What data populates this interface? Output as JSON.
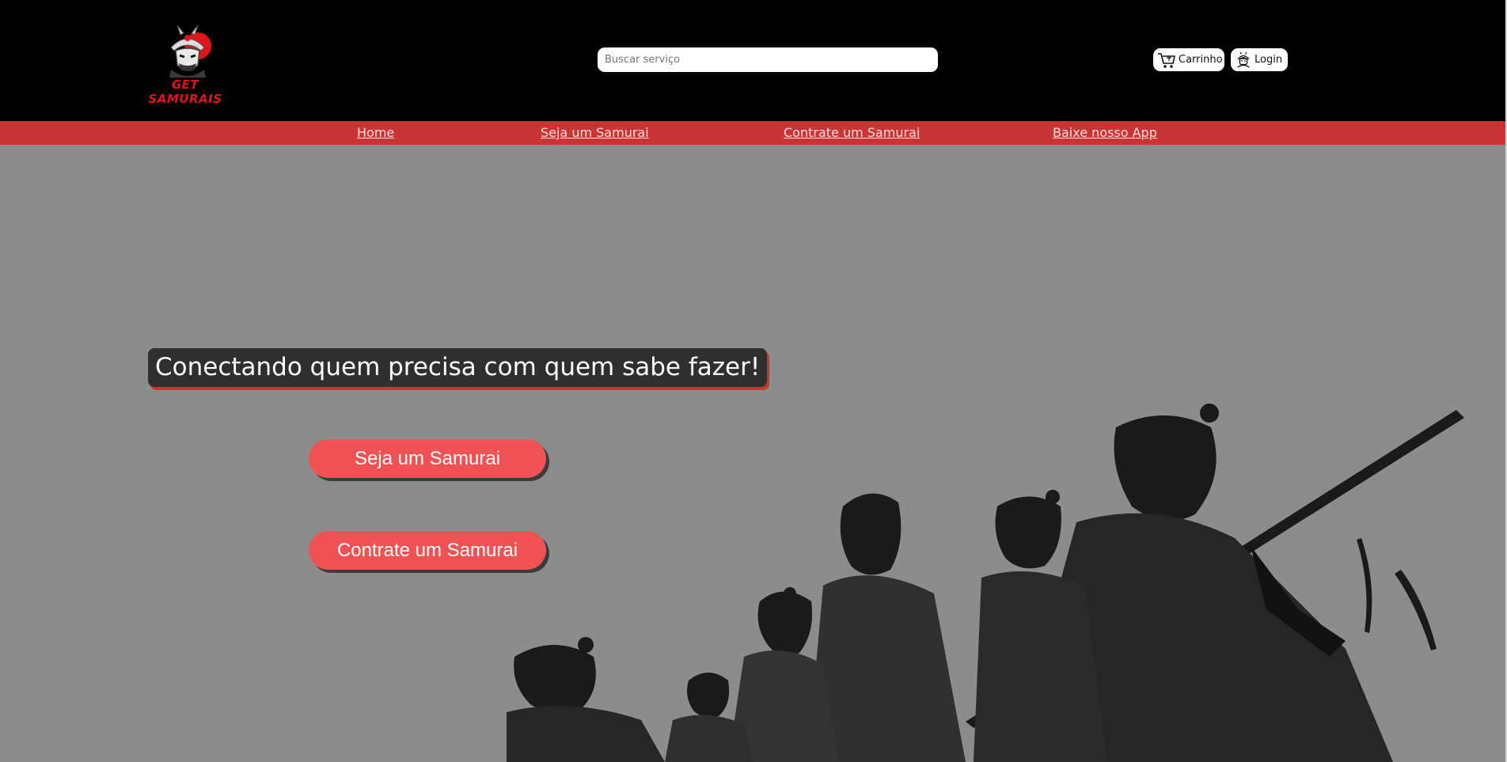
{
  "header": {
    "logo_text": "GET SAMURAIS",
    "search": {
      "placeholder": "Buscar serviço",
      "value": ""
    },
    "cart_label": "Carrinho",
    "login_label": "Login"
  },
  "nav": {
    "items": [
      {
        "label": "Home"
      },
      {
        "label": "Seja um Samurai"
      },
      {
        "label": "Contrate um Samurai"
      },
      {
        "label": "Baixe nosso App"
      }
    ]
  },
  "hero": {
    "tagline": "Conectando quem precisa com quem sabe fazer!",
    "cta_primary": "Seja um Samurai",
    "cta_secondary": "Contrate um Samurai"
  },
  "colors": {
    "header_bg": "#000000",
    "nav_bg": "#c93434",
    "page_bg": "#8c8c8c",
    "button_bg": "#f05353",
    "logo_red": "#e0151b"
  },
  "icons": [
    "samurai-logo-icon",
    "cart-icon",
    "user-icon"
  ]
}
